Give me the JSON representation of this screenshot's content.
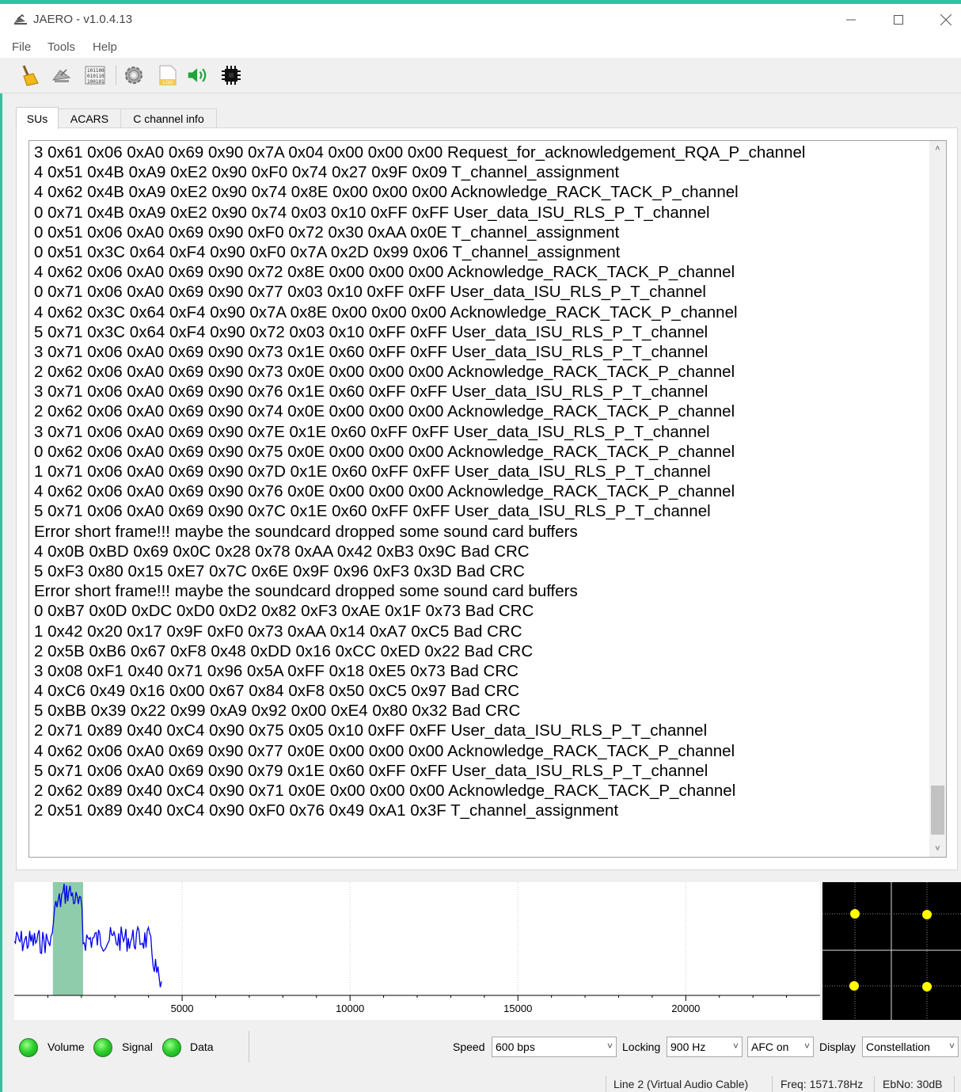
{
  "window": {
    "title": "JAERO - v1.0.4.13"
  },
  "menu": [
    "File",
    "Tools",
    "Help"
  ],
  "toolbar": {
    "icons": [
      "broom-icon",
      "satellite-dish-icon",
      "binary-data-icon",
      "gear-icon",
      "log-file-icon",
      "speaker-icon",
      "chip-icon"
    ],
    "file_label": "LOG"
  },
  "tabs": [
    {
      "label": "SUs",
      "active": true
    },
    {
      "label": "ACARS",
      "active": false
    },
    {
      "label": "C channel info",
      "active": false
    }
  ],
  "log_lines": [
    "3 0x61 0x06 0xA0 0x69 0x90 0x7A 0x04 0x00 0x00 0x00 Request_for_acknowledgement_RQA_P_channel",
    "4 0x51 0x4B 0xA9 0xE2 0x90 0xF0 0x74 0x27 0x9F 0x09 T_channel_assignment",
    "4 0x62 0x4B 0xA9 0xE2 0x90 0x74 0x8E 0x00 0x00 0x00 Acknowledge_RACK_TACK_P_channel",
    "0 0x71 0x4B 0xA9 0xE2 0x90 0x74 0x03 0x10 0xFF 0xFF User_data_ISU_RLS_P_T_channel",
    "0 0x51 0x06 0xA0 0x69 0x90 0xF0 0x72 0x30 0xAA 0x0E T_channel_assignment",
    "0 0x51 0x3C 0x64 0xF4 0x90 0xF0 0x7A 0x2D 0x99 0x06 T_channel_assignment",
    "4 0x62 0x06 0xA0 0x69 0x90 0x72 0x8E 0x00 0x00 0x00 Acknowledge_RACK_TACK_P_channel",
    "0 0x71 0x06 0xA0 0x69 0x90 0x77 0x03 0x10 0xFF 0xFF User_data_ISU_RLS_P_T_channel",
    "4 0x62 0x3C 0x64 0xF4 0x90 0x7A 0x8E 0x00 0x00 0x00 Acknowledge_RACK_TACK_P_channel",
    "5 0x71 0x3C 0x64 0xF4 0x90 0x72 0x03 0x10 0xFF 0xFF User_data_ISU_RLS_P_T_channel",
    "3 0x71 0x06 0xA0 0x69 0x90 0x73 0x1E 0x60 0xFF 0xFF User_data_ISU_RLS_P_T_channel",
    "2 0x62 0x06 0xA0 0x69 0x90 0x73 0x0E 0x00 0x00 0x00 Acknowledge_RACK_TACK_P_channel",
    "3 0x71 0x06 0xA0 0x69 0x90 0x76 0x1E 0x60 0xFF 0xFF User_data_ISU_RLS_P_T_channel",
    "2 0x62 0x06 0xA0 0x69 0x90 0x74 0x0E 0x00 0x00 0x00 Acknowledge_RACK_TACK_P_channel",
    "3 0x71 0x06 0xA0 0x69 0x90 0x7E 0x1E 0x60 0xFF 0xFF User_data_ISU_RLS_P_T_channel",
    "0 0x62 0x06 0xA0 0x69 0x90 0x75 0x0E 0x00 0x00 0x00 Acknowledge_RACK_TACK_P_channel",
    "1 0x71 0x06 0xA0 0x69 0x90 0x7D 0x1E 0x60 0xFF 0xFF User_data_ISU_RLS_P_T_channel",
    "4 0x62 0x06 0xA0 0x69 0x90 0x76 0x0E 0x00 0x00 0x00 Acknowledge_RACK_TACK_P_channel",
    "5 0x71 0x06 0xA0 0x69 0x90 0x7C 0x1E 0x60 0xFF 0xFF User_data_ISU_RLS_P_T_channel",
    "Error short frame!!! maybe the soundcard dropped some sound card buffers",
    "4 0x0B 0xBD 0x69 0x0C 0x28 0x78 0xAA 0x42 0xB3 0x9C Bad CRC",
    "5 0xF3 0x80 0x15 0xE7 0x7C 0x6E 0x9F 0x96 0xF3 0x3D Bad CRC",
    "Error short frame!!! maybe the soundcard dropped some sound card buffers",
    "0 0xB7 0x0D 0xDC 0xD0 0xD2 0x82 0xF3 0xAE 0x1F 0x73 Bad CRC",
    "1 0x42 0x20 0x17 0x9F 0xF0 0x73 0xAA 0x14 0xA7 0xC5 Bad CRC",
    "2 0x5B 0xB6 0x67 0xF8 0x48 0xDD 0x16 0xCC 0xED 0x22 Bad CRC",
    "3 0x08 0xF1 0x40 0x71 0x96 0x5A 0xFF 0x18 0xE5 0x73 Bad CRC",
    "4 0xC6 0x49 0x16 0x00 0x67 0x84 0xF8 0x50 0xC5 0x97 Bad CRC",
    "5 0xBB 0x39 0x22 0x99 0xA9 0x92 0x00 0xE4 0x80 0x32 Bad CRC",
    "2 0x71 0x89 0x40 0xC4 0x90 0x75 0x05 0x10 0xFF 0xFF User_data_ISU_RLS_P_T_channel",
    "4 0x62 0x06 0xA0 0x69 0x90 0x77 0x0E 0x00 0x00 0x00 Acknowledge_RACK_TACK_P_channel",
    "5 0x71 0x06 0xA0 0x69 0x90 0x79 0x1E 0x60 0xFF 0xFF User_data_ISU_RLS_P_T_channel",
    "2 0x62 0x89 0x40 0xC4 0x90 0x71 0x0E 0x00 0x00 0x00 Acknowledge_RACK_TACK_P_channel",
    "2 0x51 0x89 0x40 0xC4 0x90 0xF0 0x76 0x49 0xA1 0x3F T_channel_assignment"
  ],
  "spectrum": {
    "x_range": [
      0,
      24000
    ],
    "ticks": [
      5000,
      10000,
      15000,
      20000
    ],
    "tick_labels": [
      "5000",
      "10000",
      "15000",
      "20000"
    ],
    "highlight_range": [
      1150,
      2050
    ],
    "trace_color": "#0000ee",
    "highlight_color": "#8fccab"
  },
  "constellation": {
    "point_color": "#ffff00"
  },
  "indicators": [
    {
      "label": "Volume",
      "color": "#22cc22"
    },
    {
      "label": "Signal",
      "color": "#22cc22"
    },
    {
      "label": "Data",
      "color": "#22cc22"
    }
  ],
  "controls": {
    "speed_label": "Speed",
    "speed_value": "600 bps",
    "locking_label": "Locking",
    "locking_value": "900 Hz",
    "afc_value": "AFC on",
    "display_label": "Display",
    "display_value": "Constellation"
  },
  "statusbar": {
    "device": "Line 2 (Virtual Audio Cable)",
    "freq": "Freq: 1571.78Hz",
    "ebno": "EbNo: 30dB"
  },
  "colors": {
    "accent": "#2ec4a0",
    "led_green": "#22cc22"
  }
}
